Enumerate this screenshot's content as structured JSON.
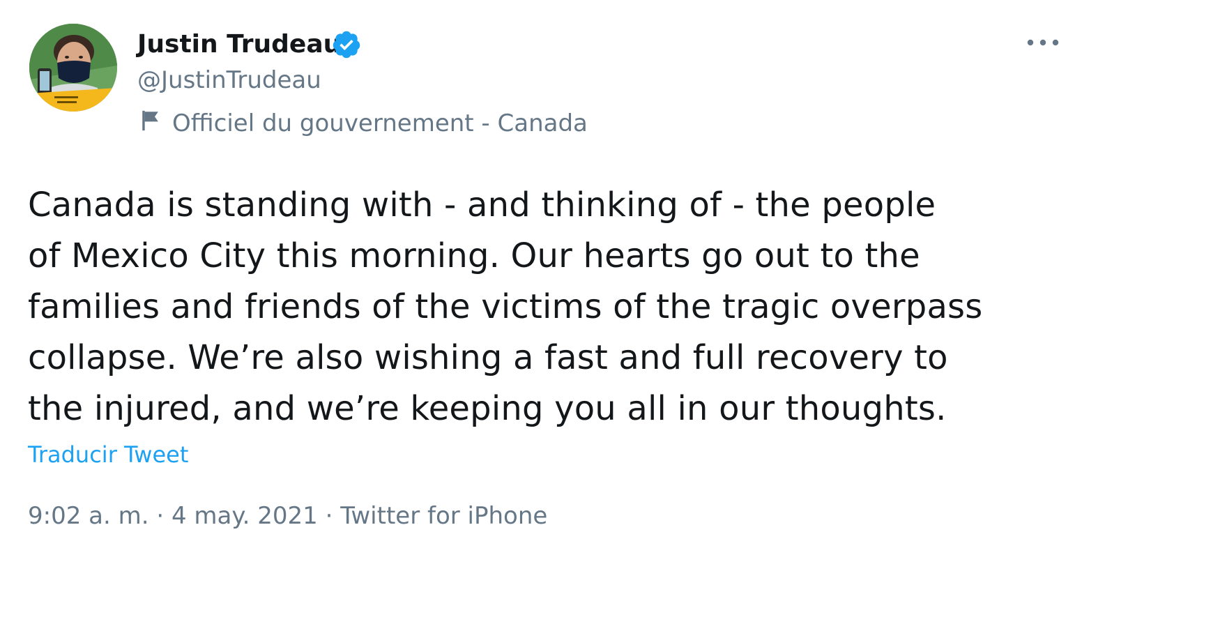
{
  "tweet": {
    "author": {
      "name": "Justin Trudeau",
      "handle": "@JustinTrudeau",
      "verified": true,
      "label": "Officiel du gouvernement - Canada"
    },
    "text": "Canada is standing with - and thinking of - the people\nof Mexico City this morning. Our hearts go out to the\nfamilies and friends of the victims of the tragic overpass\ncollapse. We’re also wishing a fast and full recovery to\nthe injured, and we’re keeping you all in our thoughts.",
    "translate_label": "Traducir Tweet",
    "time": "9:02 a. m.",
    "separator": " · ",
    "date": "4 may. 2021",
    "source": "Twitter for iPhone"
  },
  "icons": {
    "verified": "verified-badge-icon",
    "government": "flag-icon",
    "more": "more-options-icon"
  },
  "colors": {
    "link": "#1da1f2",
    "secondary_text": "#657786",
    "primary_text": "#14171a",
    "verified": "#1da1f2"
  }
}
